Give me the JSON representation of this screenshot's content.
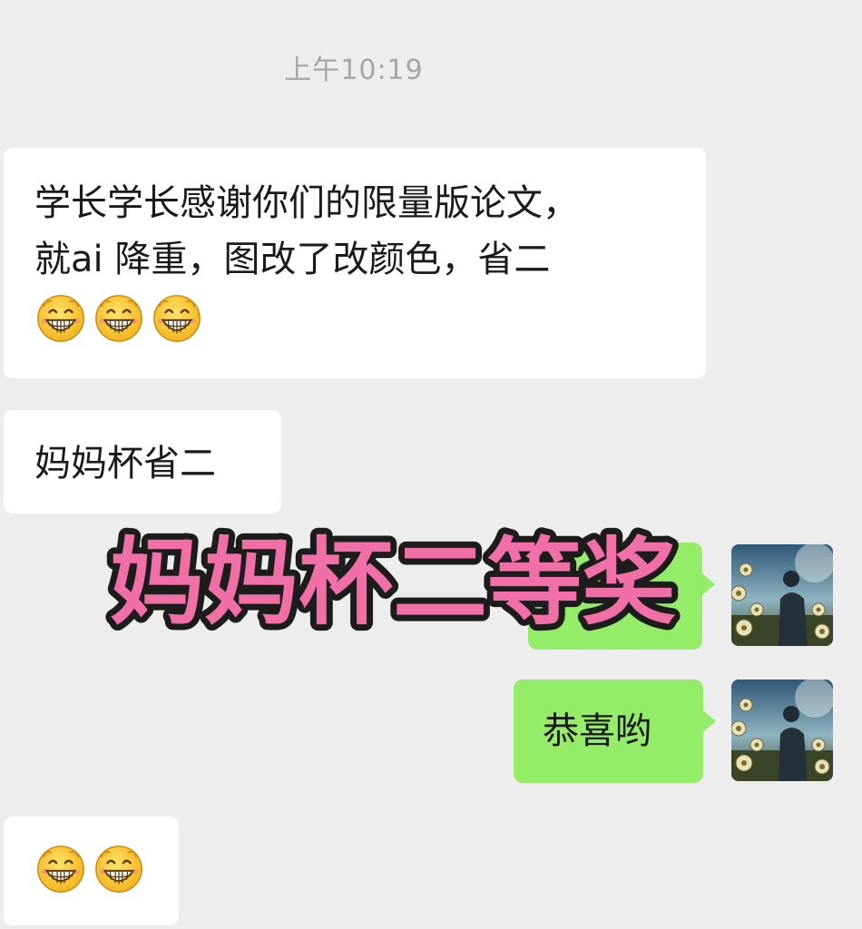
{
  "chat": {
    "timestamp": "上午10:19",
    "messages": [
      {
        "side": "incoming",
        "lines": [
          "学长学长感谢你们的限量版论文，",
          "就ai 降重，图改了改颜色，省二"
        ],
        "emojis": [
          "grin-emoji",
          "grin-emoji",
          "grin-emoji"
        ]
      },
      {
        "side": "incoming",
        "text": "妈妈杯省二"
      },
      {
        "side": "outgoing",
        "text": ""
      },
      {
        "side": "outgoing",
        "text": "恭喜哟"
      },
      {
        "side": "incoming",
        "emojis": [
          "grin-emoji",
          "grin-emoji"
        ]
      }
    ]
  },
  "overlay": {
    "text": "妈妈杯二等奖",
    "fill_color": "#f06fa6",
    "outline_color": "#1c1c1c"
  },
  "colors": {
    "background": "#ededed",
    "incoming_bubble": "#ffffff",
    "outgoing_bubble": "#95ec69"
  }
}
